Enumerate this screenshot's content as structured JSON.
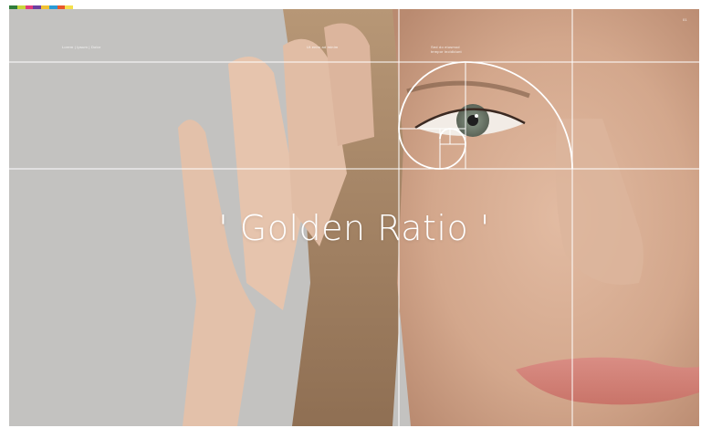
{
  "header": {
    "color_strip": [
      "#2f7d3a",
      "#c8d63a",
      "#e03b7c",
      "#6a3fa0",
      "#f1c232",
      "#2a9bd6",
      "#e7572b",
      "#f4e04d"
    ],
    "breadcrumb": "Lorem  |  Ipsum  |  Dolor",
    "note_center": "Ut enim ad minim",
    "note_right": "Sed do eiusmod\ntempor incididunt",
    "page_number": "01"
  },
  "title": "' Golden Ratio '",
  "colors": {
    "grid_line": "#ffffff",
    "title_text": "#ffffff"
  }
}
